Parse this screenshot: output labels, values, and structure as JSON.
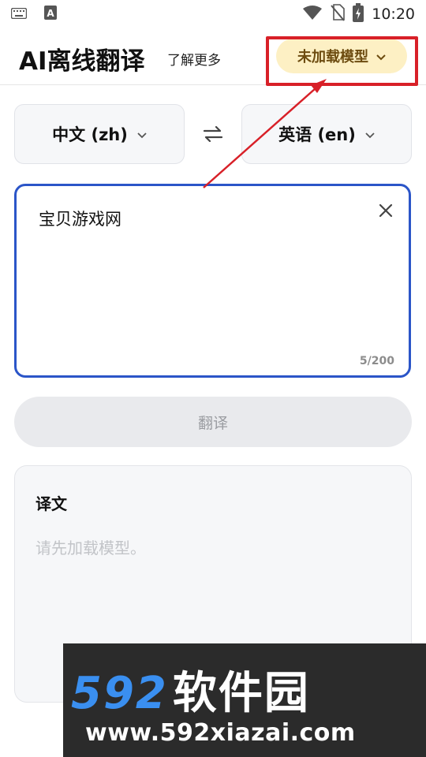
{
  "status_bar": {
    "time": "10:20",
    "left_icons": [
      "keyboard-icon",
      "text-app-icon"
    ],
    "right_icons": [
      "wifi-icon",
      "no-sim-icon",
      "battery-charging-icon"
    ]
  },
  "header": {
    "title": "AI离线翻译",
    "learn_more": "了解更多",
    "model_status": "未加载模型"
  },
  "languages": {
    "source": "中文 (zh)",
    "target": "英语 (en)"
  },
  "input": {
    "value": "宝贝游戏网",
    "char_count": "5/200"
  },
  "actions": {
    "translate_label": "翻译"
  },
  "result": {
    "title": "译文",
    "placeholder": "请先加载模型。"
  },
  "watermark": {
    "logo_digits": "592",
    "logo_text": "软件园",
    "url": "www.592xiazai.com"
  },
  "colors": {
    "accent_blue": "#2b55c8",
    "model_pill_bg": "#fdf0c4",
    "model_pill_text": "#6d4c10",
    "annotation_red": "#d82028",
    "watermark_blue": "#3a8ff0"
  }
}
